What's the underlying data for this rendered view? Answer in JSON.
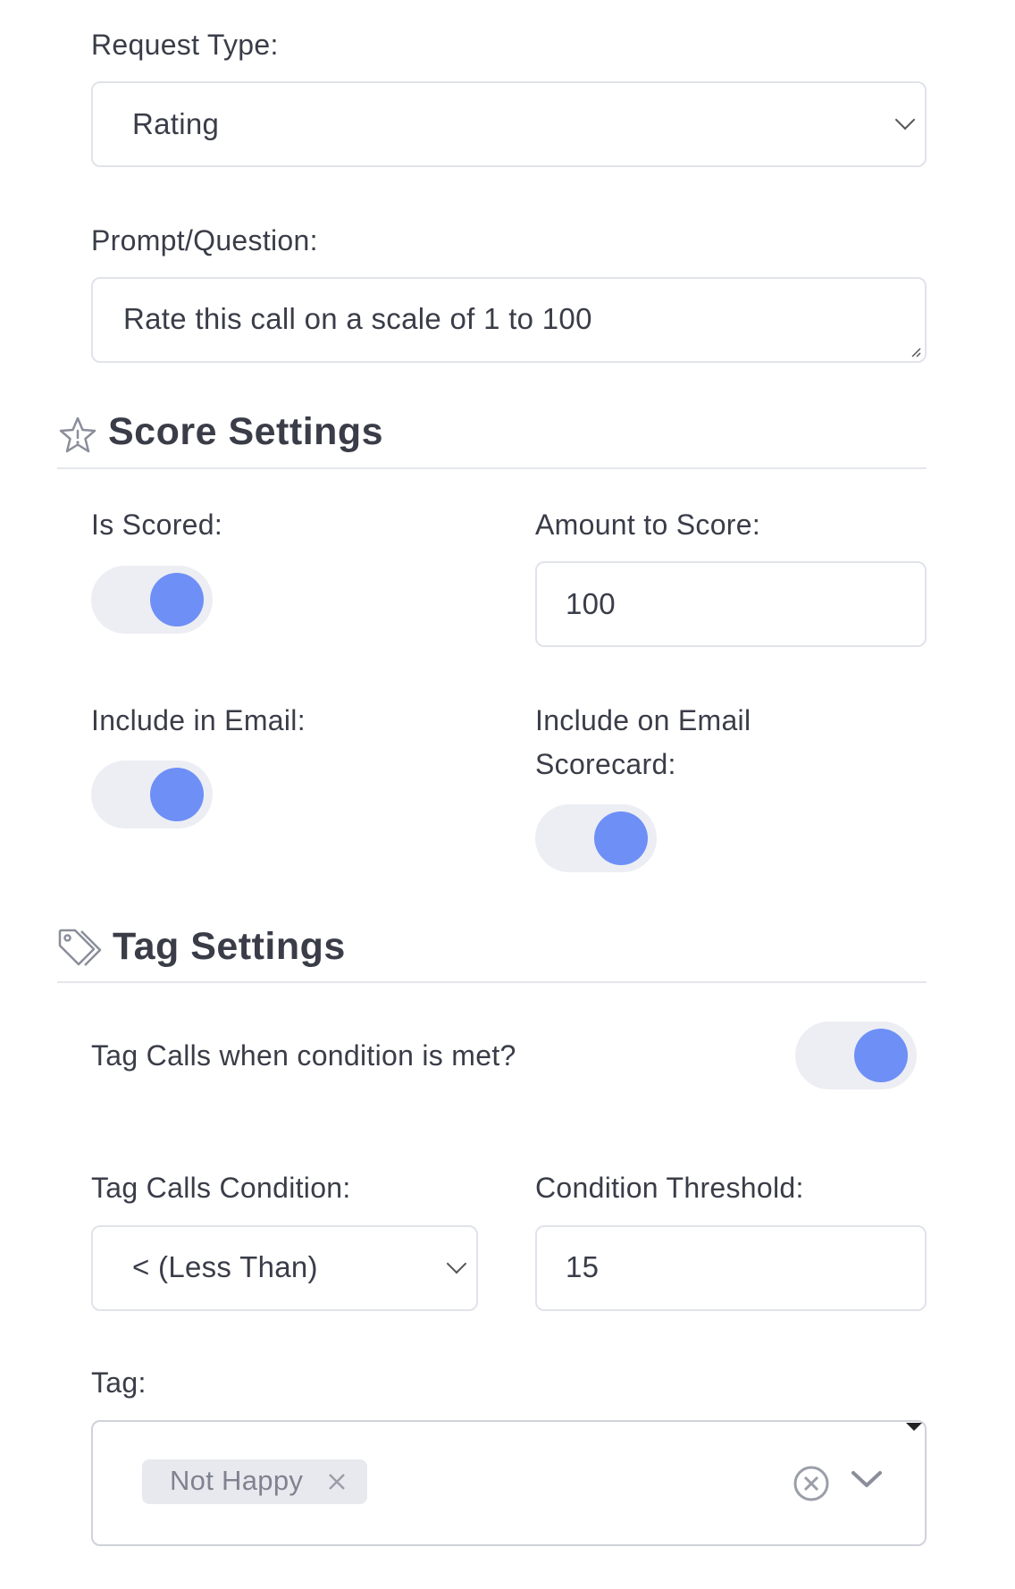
{
  "request_type": {
    "label": "Request Type:",
    "value": "Rating"
  },
  "prompt": {
    "label": "Prompt/Question:",
    "value": "Rate this call on a scale of 1 to 100"
  },
  "score_settings": {
    "title": "Score Settings",
    "icon": "star-icon",
    "is_scored": {
      "label": "Is Scored:",
      "on": true
    },
    "amount_to_score": {
      "label": "Amount to Score:",
      "value": "100"
    },
    "include_in_email": {
      "label": "Include in Email:",
      "on": true
    },
    "include_on_email_scorecard": {
      "label_line1": "Include on Email",
      "label_line2": "Scorecard:",
      "on": true
    }
  },
  "tag_settings": {
    "title": "Tag Settings",
    "icon": "tag-icon",
    "tag_calls_toggle": {
      "label": "Tag Calls when condition is met?",
      "on": true
    },
    "condition": {
      "label": "Tag Calls Condition:",
      "value": "< (Less Than)"
    },
    "threshold": {
      "label": "Condition Threshold:",
      "value": "15"
    },
    "tag": {
      "label": "Tag:",
      "selected": [
        "Not Happy"
      ]
    }
  },
  "colors": {
    "accent": "#6e8ff6",
    "toggle_track": "#eceef3",
    "border": "#e1e3ea"
  }
}
